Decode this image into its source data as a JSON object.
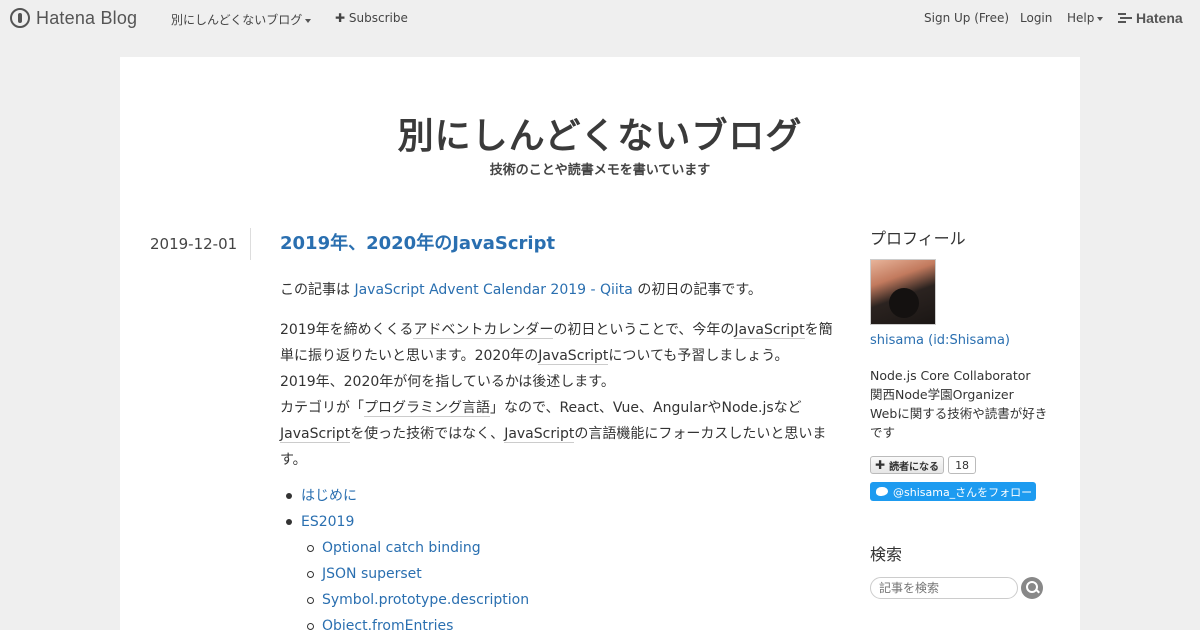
{
  "header": {
    "brand": "Hatena Blog",
    "blog_menu": "別にしんどくないブログ",
    "subscribe": "Subscribe",
    "signup": "Sign Up (Free)",
    "login": "Login",
    "help": "Help",
    "hatena": "Hatena"
  },
  "blog": {
    "title": "別にしんどくないブログ",
    "description": "技術のことや読書メモを書いています"
  },
  "entry": {
    "date": "2019-12-01",
    "title": "2019年、2020年のJavaScript",
    "intro_prefix": "この記事は ",
    "intro_link": "JavaScript Advent Calendar 2019 - Qiita",
    "intro_suffix": " の初日の記事です。",
    "p1_a": "2019年を締めくくる",
    "p1_kw1": "アドベントカレンダー",
    "p1_b": "の初日ということで、今年の",
    "p1_kw2": "JavaScript",
    "p1_c": "を簡単に振り返りたいと思います。2020年の",
    "p1_kw3": "JavaScript",
    "p1_d": "についても予習しましょう。",
    "p1_line2": "2019年、2020年が何を指しているかは後述します。",
    "p1_e": "カテゴリが「",
    "p1_kw4": "プログラミング言語",
    "p1_f": "」なので、React、Vue、AngularやNode.jsなど",
    "p1_kw5": "JavaScript",
    "p1_g": "を使った技術ではなく、",
    "p1_kw6": "JavaScript",
    "p1_h": "の言語機能にフォーカスしたいと思います。",
    "toc": [
      {
        "label": "はじめに"
      },
      {
        "label": "ES2019",
        "children": [
          "Optional catch binding",
          "JSON superset",
          "Symbol.prototype.description",
          "Object.fromEntries"
        ]
      }
    ]
  },
  "sidebar": {
    "profile_title": "プロフィール",
    "profile_name": "shisama (id:Shisama)",
    "desc_line1": "Node.js Core Collaborator",
    "desc_line2": "関西Node学園Organizer",
    "desc_line3": "Webに関する技術や読書が好きです",
    "reader_button": "読者になる",
    "reader_count": "18",
    "follow_button": "@shisama_さんをフォロー",
    "search_title": "検索",
    "search_placeholder": "記事を検索"
  }
}
